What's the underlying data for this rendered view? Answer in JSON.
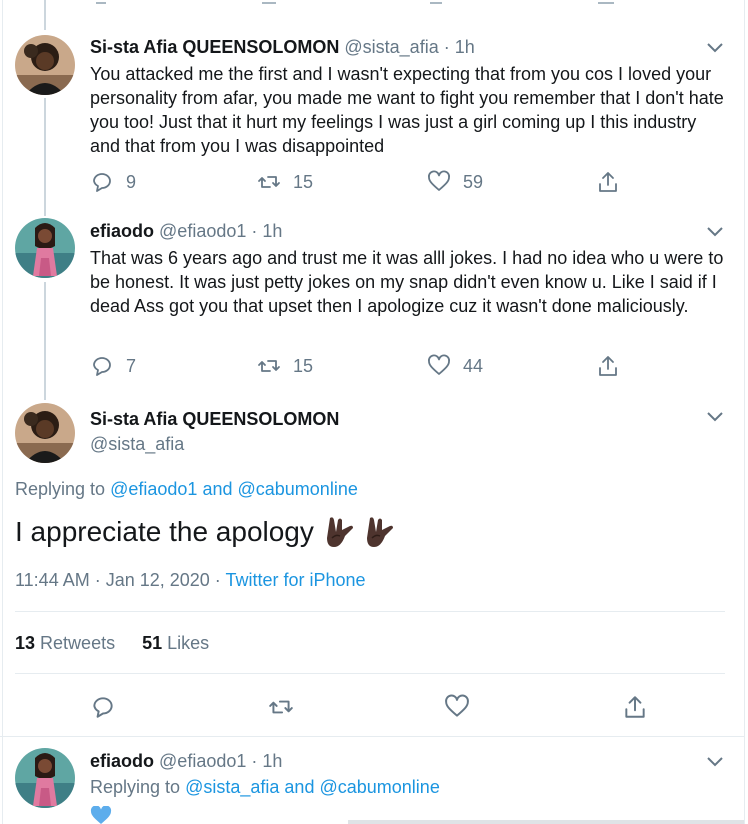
{
  "tweets": [
    {
      "name": "Si-sta Afia QUEENSOLOMON",
      "handle": "@sista_afia",
      "time": "· 1h",
      "text": "You attacked me the first and I wasn't expecting that from you cos I loved your personality from afar, you made me want to fight you remember that I don't hate you too! Just that it hurt my feelings I was just a girl coming up I this industry and that from you I was disappointed",
      "replies": "9",
      "retweets": "15",
      "likes": "59"
    },
    {
      "name": "efiaodo",
      "handle": "@efiaodo1",
      "time": "· 1h",
      "text": "That was 6 years ago and trust me it was alll jokes. I had no idea who u were to be honest. It was just petty jokes on my snap didn't even know u. Like I said if I dead Ass got you that upset then I apologize cuz it wasn't done maliciously.",
      "replies": "7",
      "retweets": "15",
      "likes": "44"
    }
  ],
  "focus": {
    "name": "Si-sta Afia QUEENSOLOMON",
    "handle": "@sista_afia",
    "replying_prefix": "Replying to",
    "mention1": "@efiaodo1",
    "and": "and",
    "mention2": "@cabumonline",
    "text": "I appreciate the apology",
    "timestamp": "11:44 AM · Jan 12, 2020 · ",
    "source": "Twitter for iPhone",
    "retweets_count": "13",
    "retweets_label": "Retweets",
    "likes_count": "51",
    "likes_label": "Likes"
  },
  "reply": {
    "name": "efiaodo",
    "handle": "@efiaodo1",
    "time": "· 1h",
    "replying_prefix": "Replying to",
    "mention1": "@sista_afia",
    "and": "and",
    "mention2": "@cabumonline"
  },
  "icons": [
    "reply-icon",
    "retweet-icon",
    "like-icon",
    "share-icon",
    "chevron-down-icon",
    "rock-on-hand-emoji",
    "blue-heart-emoji"
  ],
  "colors": {
    "link": "#1b95e0",
    "secondary": "#657786",
    "text": "#14171a",
    "divider": "#e6ecf0"
  }
}
